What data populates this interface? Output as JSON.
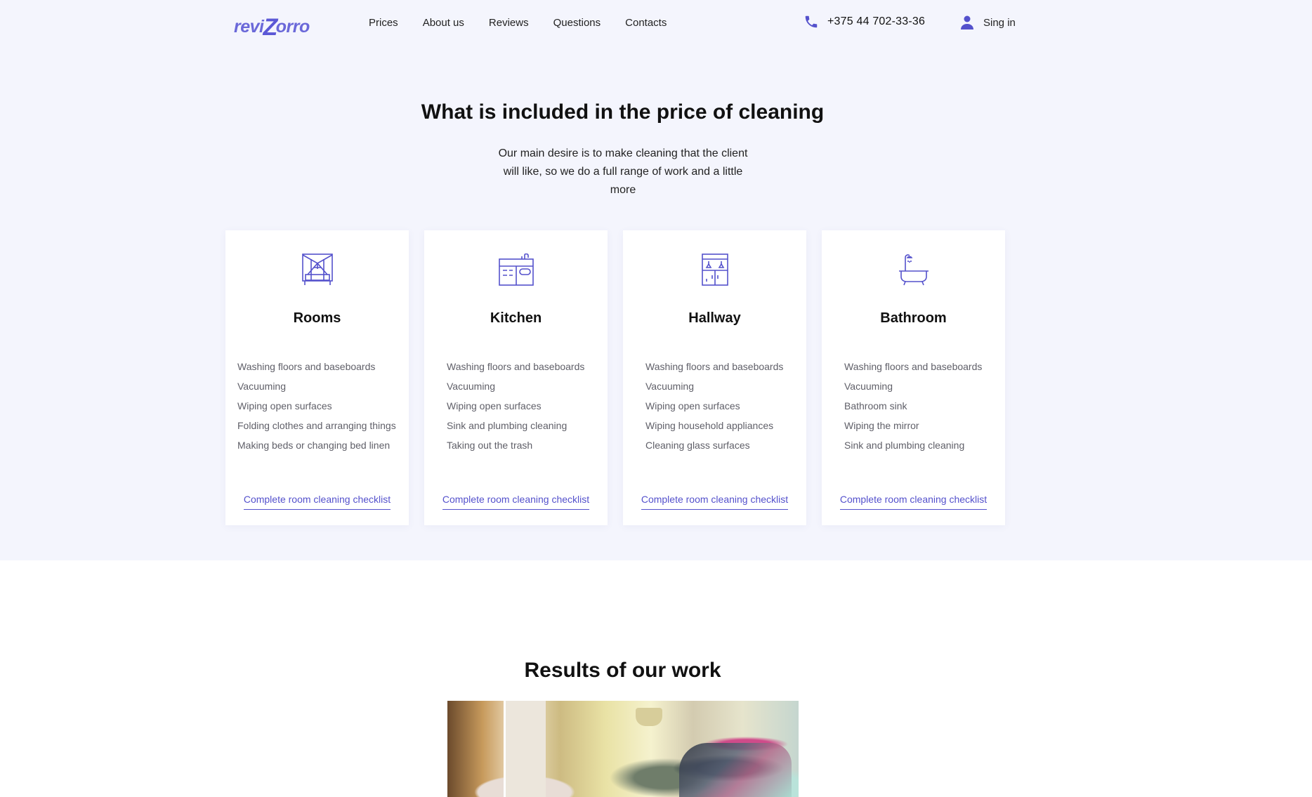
{
  "header": {
    "logo_text": "reviZorro",
    "nav": [
      "Prices",
      "About us",
      "Reviews",
      "Questions",
      "Contacts"
    ],
    "phone": "+375 44 702-33-36",
    "signin_label": "Sing in"
  },
  "colors": {
    "accent": "#5451cc",
    "band_background": "#f4f5fd",
    "card_background": "#ffffff",
    "list_text": "#5f5f68"
  },
  "included": {
    "title": "What is included in the price of cleaning",
    "subtitle": "Our main desire is to make cleaning that the client will like, so we do a full range of work and a little more",
    "cards": [
      {
        "icon": "bed-icon",
        "title": "Rooms",
        "items": [
          "Washing floors and baseboards",
          "Vacuuming",
          "Wiping open surfaces",
          "Folding clothes and arranging things",
          "Making beds or changing bed linen"
        ],
        "link": "Complete room cleaning checklist"
      },
      {
        "icon": "kitchen-icon",
        "title": "Kitchen",
        "items": [
          "Washing floors and baseboards",
          "Vacuuming",
          "Wiping open surfaces",
          "Sink and plumbing cleaning",
          "Taking out the trash"
        ],
        "link": "Complete room cleaning checklist"
      },
      {
        "icon": "wardrobe-icon",
        "title": "Hallway",
        "items": [
          "Washing floors and baseboards",
          "Vacuuming",
          "Wiping household appliances",
          "Wiping household appliances",
          "Cleaning glass surfaces"
        ],
        "link": "Complete room cleaning checklist"
      },
      {
        "icon": "bathtub-icon",
        "title": "Bathroom",
        "items": [
          "Washing floors and baseboards",
          "Vacuuming",
          "Bathroom sink",
          "Wiping the mirror",
          "Sink and plumbing cleaning"
        ],
        "link": "Complete room cleaning checklist"
      }
    ]
  },
  "results": {
    "title": "Results of our work",
    "photo": "messy-bedroom-photo"
  }
}
